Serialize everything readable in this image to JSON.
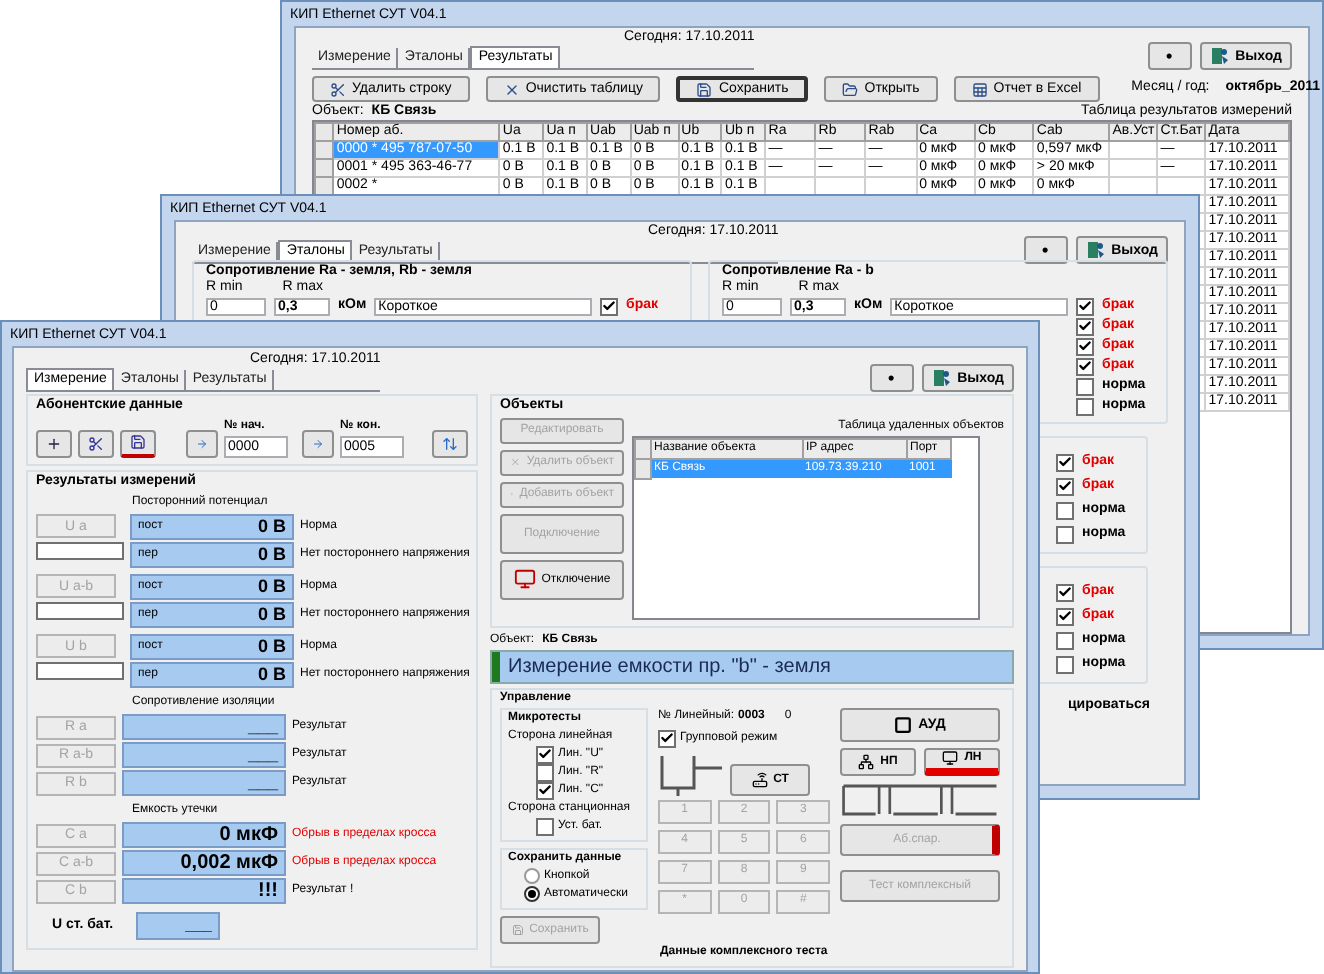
{
  "results_window": {
    "title": "КИП Ethernet СУТ V04.1",
    "today": "Сегодня: 17.10.2011",
    "tabs": [
      {
        "label": "Измерение",
        "selected": false
      },
      {
        "label": "Эталоны",
        "selected": false
      },
      {
        "label": "Результаты",
        "selected": true
      }
    ],
    "dot_button": "•",
    "exit_button": "Выход",
    "toolbar": [
      {
        "label": "Удалить строку",
        "focused": false
      },
      {
        "label": "Очистить таблицу",
        "focused": false
      },
      {
        "label": "Сохранить",
        "focused": true
      },
      {
        "label": "Открыть",
        "focused": false
      },
      {
        "label": "Отчет в Excel",
        "focused": false
      }
    ],
    "month_label": "Месяц / год:",
    "month_value": "октябрь_2011",
    "object_label": "Объект:",
    "object_value": "КБ Связь",
    "table_caption": "Таблица результатов измерений",
    "columns": [
      "Номер аб.",
      "Ua",
      "Ua п",
      "Uab",
      "Uab п",
      "Ub",
      "Ub п",
      "Ra",
      "Rb",
      "Rab",
      "Ca",
      "Cb",
      "Cab",
      "Ав.Уст",
      "Ст.Бат",
      "Дата"
    ],
    "rows": [
      {
        "selected": true,
        "cells": [
          "0000 * 495 787-07-50",
          "0.1 В",
          "0.1 В",
          "0.1 В",
          "0 В",
          "0.1 В",
          "0.1 В",
          "—",
          "—",
          "—",
          "0 мкФ",
          "0 мкФ",
          "0,597 мкФ",
          null,
          "—",
          "17.10.2011"
        ]
      },
      {
        "selected": false,
        "cells": [
          "0001 * 495 363-46-77",
          "0 В",
          "0.1 В",
          "0 В",
          "0 В",
          "0.1 В",
          "0.1 В",
          "—",
          "—",
          "—",
          "0 мкФ",
          "0 мкФ",
          "> 20 мкФ",
          null,
          "—",
          "17.10.2011"
        ]
      },
      {
        "selected": false,
        "cells": [
          "0002 *",
          "0 В",
          "0.1 В",
          "0 В",
          "0 В",
          "0.1 В",
          "0.1 В",
          null,
          null,
          null,
          "0 мкФ",
          "0 мкФ",
          "0 мкФ",
          null,
          null,
          "17.10.2011"
        ]
      }
    ],
    "more_rows": [
      {
        "date": "17.10.2011"
      },
      {
        "date": "17.10.2011"
      },
      {
        "date": "17.10.2011"
      },
      {
        "date": "17.10.2011"
      },
      {
        "date": "17.10.2011"
      },
      {
        "date": "17.10.2011"
      },
      {
        "date": "17.10.2011"
      },
      {
        "date": "17.10.2011"
      },
      {
        "date": "17.10.2011"
      },
      {
        "date": "17.10.2011"
      },
      {
        "date": "17.10.2011"
      },
      {
        "date": "17.10.2011"
      }
    ]
  },
  "standards_window": {
    "title": "КИП Ethernet СУТ V04.1",
    "today": "Сегодня: 17.10.2011",
    "tabs": [
      {
        "label": "Измерение",
        "selected": false
      },
      {
        "label": "Эталоны",
        "selected": true
      },
      {
        "label": "Результаты",
        "selected": false
      }
    ],
    "dot_button": "•",
    "exit_button": "Выход",
    "groups": [
      {
        "title": "Сопротивление Ra - земля, Rb - земля",
        "rmin_label": "R min",
        "rmax_label": "R max",
        "rows": [
          {
            "rmin": "0",
            "rmax": "0,3",
            "unit": "кОм",
            "text": "Короткое",
            "checked": true,
            "verdict": "брак"
          }
        ]
      },
      {
        "title": "Сопротивление Ra - b",
        "rmin_label": "R min",
        "rmax_label": "R max",
        "rows": [
          {
            "rmin": "0",
            "rmax": "0,3",
            "unit": "кОм",
            "text": "Короткое",
            "checked": true,
            "verdict": "брак"
          },
          {
            "checked": true,
            "verdict": "брак"
          },
          {
            "checked": true,
            "verdict": "брак"
          },
          {
            "checked": true,
            "verdict": "брак"
          },
          {
            "checked": false,
            "verdict": "норма"
          },
          {
            "checked": false,
            "verdict": "норма"
          }
        ]
      },
      {
        "rows": [
          {
            "checked": true,
            "verdict": "брак"
          },
          {
            "checked": true,
            "verdict": "брак"
          },
          {
            "checked": false,
            "verdict": "норма"
          },
          {
            "checked": false,
            "verdict": "норма"
          }
        ]
      },
      {
        "rows": [
          {
            "checked": true,
            "verdict": "брак"
          },
          {
            "checked": true,
            "verdict": "брак"
          },
          {
            "checked": false,
            "verdict": "норма"
          },
          {
            "checked": false,
            "verdict": "норма"
          }
        ]
      }
    ],
    "tail_text": "цироваться"
  },
  "measure_window": {
    "title": "КИП Ethernet СУТ V04.1",
    "today": "Сегодня: 17.10.2011",
    "tabs": [
      {
        "label": "Измерение",
        "selected": true
      },
      {
        "label": "Эталоны",
        "selected": false
      },
      {
        "label": "Результаты",
        "selected": false
      }
    ],
    "dot_button": "•",
    "exit_button": "Выход",
    "subscriber": {
      "title": "Абонентские данные",
      "start_label": "№ нач.",
      "start_value": "0000",
      "end_label": "№ кон.",
      "end_value": "0005"
    },
    "results": {
      "title": "Результаты измерений",
      "voltage_title": "Посторонний потенциал",
      "voltage": [
        {
          "button": "U a",
          "dc_label": "пост",
          "dc_value": "0 В",
          "dc_status": "Норма",
          "ac_label": "пер",
          "ac_value": "0 В",
          "ac_status": "Нет постороннего напряжения"
        },
        {
          "button": "U a-b",
          "dc_label": "пост",
          "dc_value": "0 В",
          "dc_status": "Норма",
          "ac_label": "пер",
          "ac_value": "0 В",
          "ac_status": "Нет постороннего напряжения"
        },
        {
          "button": "U b",
          "dc_label": "пост",
          "dc_value": "0 В",
          "dc_status": "Норма",
          "ac_label": "пер",
          "ac_value": "0 В",
          "ac_status": "Нет постороннего напряжения"
        }
      ],
      "insulation_title": "Сопротивление изоляции",
      "insulation": [
        {
          "button": "R a",
          "value": "___",
          "status": "Результат",
          "alarm": false
        },
        {
          "button": "R a-b",
          "value": "___",
          "status": "Результат",
          "alarm": false
        },
        {
          "button": "R b",
          "value": "___",
          "status": "Результат",
          "alarm": false
        }
      ],
      "capacitance_title": "Емкость утечки",
      "capacitance": [
        {
          "button": "C a",
          "value": "0 мкФ",
          "status": "Обрыв в пределах кросса",
          "alarm": true
        },
        {
          "button": "C a-b",
          "value": "0,002 мкФ",
          "status": "Обрыв в пределах кросса",
          "alarm": true
        },
        {
          "button": "C b",
          "value": "!!!",
          "status": "Результат !",
          "alarm": false
        }
      ],
      "battery_label": "U ст. бат.",
      "battery_value": "___"
    },
    "objects": {
      "title": "Объекты",
      "buttons": [
        {
          "label": "Редактировать",
          "disabled": true
        },
        {
          "label": "Удалить объект",
          "disabled": true
        },
        {
          "label": "Добавить объект",
          "disabled": true
        },
        {
          "label": "Подключение",
          "disabled": true
        },
        {
          "label": "Отключение",
          "disabled": false
        }
      ],
      "table_caption": "Таблица удаленных объектов",
      "columns": [
        "Название объекта",
        "IP адрес",
        "Порт"
      ],
      "rows": [
        {
          "selected": true,
          "cells": [
            "КБ Связь",
            "109.73.39.210",
            "1001"
          ]
        }
      ]
    },
    "current_object_label": "Объект:",
    "current_object_value": "КБ Связь",
    "banner": "Измерение емкости пр. \"b\" - земля",
    "control": {
      "title": "Управление",
      "microtests": {
        "title": "Микротесты",
        "line_side": "Сторона линейная",
        "line_tests": [
          {
            "label": "Лин. \"U\"",
            "checked": true
          },
          {
            "label": "Лин. \"R\"",
            "checked": false
          },
          {
            "label": "Лин. \"C\"",
            "checked": true
          }
        ],
        "station_side": "Сторона станционная",
        "station_tests": [
          {
            "label": "Уст. бат.",
            "checked": false
          }
        ]
      },
      "save_data": {
        "title": "Сохранить данные",
        "options": [
          {
            "label": "Кнопкой",
            "selected": false
          },
          {
            "label": "Автоматически",
            "selected": true
          }
        ]
      },
      "save_button": {
        "label": "Сохранить",
        "disabled": true
      },
      "complex_caption": "Данные комплексного теста",
      "line_number_label": "№ Линейный:",
      "line_number_value": "0003",
      "line_counter": "0",
      "group_mode": {
        "label": "Групповой режим",
        "checked": true
      },
      "st_button": "СТ",
      "keypad_disabled": true,
      "keypad": [
        "1",
        "2",
        "3",
        "4",
        "5",
        "6",
        "7",
        "8",
        "9",
        "*",
        "0",
        "#"
      ],
      "aud_button": "АУД",
      "np_button": "НП",
      "ln_button": {
        "label": "ЛН",
        "active": true
      },
      "pair_button": {
        "label": "Аб.спар.",
        "disabled": true
      },
      "complex_test_button": {
        "label": "Тест комплексный",
        "disabled": true
      }
    }
  }
}
